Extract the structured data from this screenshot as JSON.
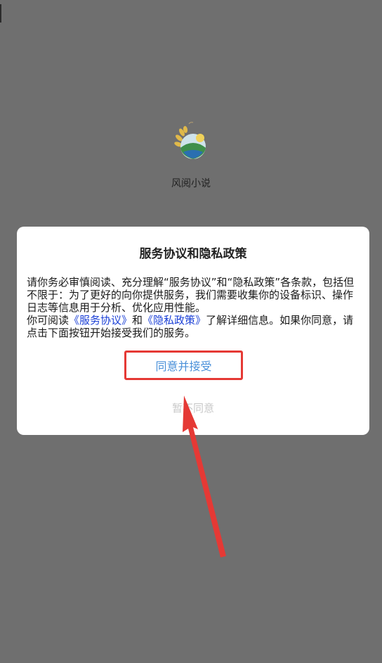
{
  "app": {
    "name": "风阅小说",
    "logo": "wheat-landscape-logo"
  },
  "dialog": {
    "title": "服务协议和隐私政策",
    "para1": "请你务必审慎阅读、充分理解“服务协议”和“隐私政策”各条款，包括但不限于：为了更好的向你提供服务，我们需要收集你的设备标识、操作日志等信息用于分析、优化应用性能。",
    "para2_prefix": "你可阅读",
    "link_service": "《服务协议》",
    "para2_and": "和",
    "link_privacy": "《隐私政策》",
    "para2_suffix": "了解详细信息。如果你同意，请点击下面按钮开始接受我们的服务。",
    "accept_label": "同意并接受",
    "decline_label": "暂不同意"
  },
  "colors": {
    "overlay": "#6f6f6f",
    "link": "#1a3fd6",
    "accept_text": "#4a90d9",
    "highlight": "#e53935"
  }
}
